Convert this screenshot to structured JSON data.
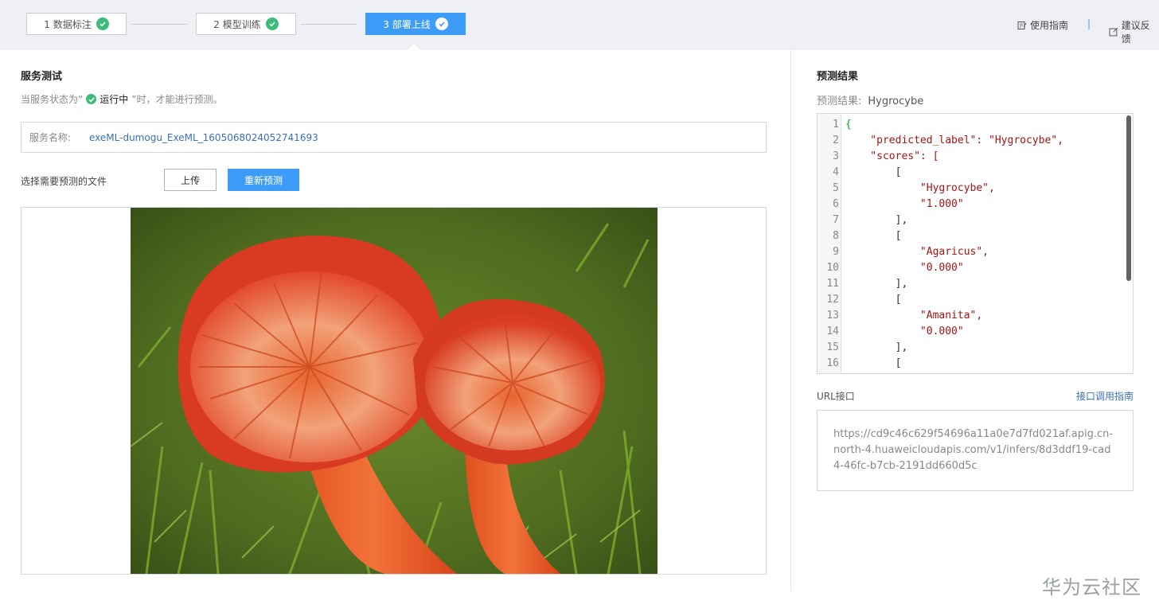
{
  "steps": [
    {
      "label": "1 数据标注",
      "state": "done"
    },
    {
      "label": "2 模型训练",
      "state": "done"
    },
    {
      "label": "3 部署上线",
      "state": "active"
    }
  ],
  "top_links": {
    "guide": "使用指南",
    "separator": "|",
    "feedback": "建议反馈"
  },
  "service_test": {
    "title": "服务测试",
    "hint_prefix": "当服务状态为“",
    "hint_status": "运行中",
    "hint_suffix": "”时，才能进行预测。",
    "name_label": "服务名称:",
    "name_value": "exeML-dumogu_ExeML_1605068024052741693",
    "file_label": "选择需要预测的文件",
    "upload_button": "上传",
    "repredict_button": "重新预测"
  },
  "prediction": {
    "title": "预测结果",
    "result_label": "预测结果:",
    "result_value": "Hygrocybe",
    "code_lines": [
      "{",
      "    \"predicted_label\": \"Hygrocybe\",",
      "    \"scores\": [",
      "        [",
      "            \"Hygrocybe\",",
      "            \"1.000\"",
      "        ],",
      "        [",
      "            \"Agaricus\",",
      "            \"0.000\"",
      "        ],",
      "        [",
      "            \"Amanita\",",
      "            \"0.000\"",
      "        ],",
      "        ["
    ]
  },
  "url_section": {
    "title": "URL接口",
    "guide_link": "接口调用指南",
    "url": "https://cd9c46c629f54696a11a0e7d7fd021af.apig.cn-north-4.huaweicloudapis.com/v1/infers/8d3ddf19-cad4-46fc-b7cb-2191dd660d5c"
  },
  "watermark": "华为云社区",
  "colors": {
    "primary": "#3c9cf7",
    "success": "#3dbb78",
    "link": "#3a6fb7"
  }
}
